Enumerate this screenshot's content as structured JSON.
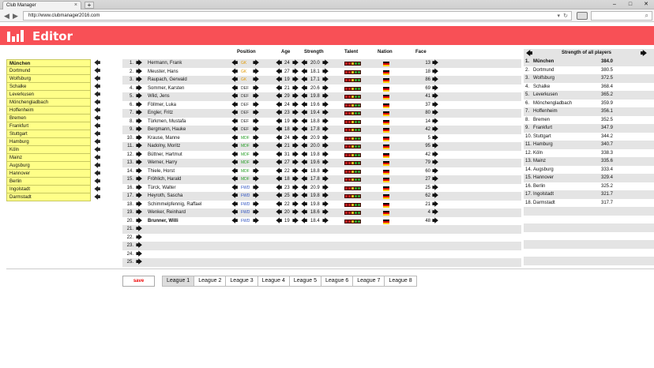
{
  "browser": {
    "tab_title": "Club Manager",
    "new_tab": "+",
    "url": "http://www.clubmanager2016.com",
    "window_controls": [
      "–",
      "□",
      "✕"
    ]
  },
  "header": {
    "title": "Editor"
  },
  "columns": {
    "position": "Position",
    "age": "Age",
    "strength": "Strength",
    "talent": "Talent",
    "nation": "Nation",
    "face": "Face"
  },
  "clubs": [
    "München",
    "Dortmund",
    "Wolfsburg",
    "Schalke",
    "Leverkusen",
    "Mönchengladbach",
    "Hoffenheim",
    "Bremen",
    "Frankfurt",
    "Stuttgart",
    "Hamburg",
    "Köln",
    "Mainz",
    "Augsburg",
    "Hannover",
    "Berlin",
    "Ingolstadt",
    "Darmstadt"
  ],
  "players": [
    {
      "num": "1.",
      "name": "Hermann, Frank",
      "pos": "GK",
      "age": "24",
      "strength": "20.0",
      "face": "13"
    },
    {
      "num": "2.",
      "name": "Meuster, Hans",
      "pos": "GK",
      "age": "27",
      "strength": "18.1",
      "face": "18"
    },
    {
      "num": "3.",
      "name": "Raupach, Gerwald",
      "pos": "GK",
      "age": "19",
      "strength": "17.1",
      "face": "86"
    },
    {
      "num": "4.",
      "name": "Sommer, Karsten",
      "pos": "DEF",
      "age": "21",
      "strength": "20.6",
      "face": "69"
    },
    {
      "num": "5.",
      "name": "Wild, Jens",
      "pos": "DEF",
      "age": "29",
      "strength": "19.8",
      "face": "41"
    },
    {
      "num": "6.",
      "name": "Föllmer, Luka",
      "pos": "DEF",
      "age": "24",
      "strength": "19.6",
      "face": "37"
    },
    {
      "num": "7.",
      "name": "Engler, Fritz",
      "pos": "DEF",
      "age": "23",
      "strength": "19.4",
      "face": "80"
    },
    {
      "num": "8.",
      "name": "Türkmen, Mustafa",
      "pos": "DEF",
      "age": "19",
      "strength": "18.8",
      "face": "14"
    },
    {
      "num": "9.",
      "name": "Bergmann, Hauke",
      "pos": "DEF",
      "age": "18",
      "strength": "17.8",
      "face": "42"
    },
    {
      "num": "10.",
      "name": "Krause, Manne",
      "pos": "MDF",
      "age": "24",
      "strength": "20.9",
      "face": "5"
    },
    {
      "num": "11.",
      "name": "Nadolny, Moritz",
      "pos": "MDF",
      "age": "21",
      "strength": "20.0",
      "face": "95"
    },
    {
      "num": "12.",
      "name": "Büttner, Hartmut",
      "pos": "MDF",
      "age": "31",
      "strength": "19.8",
      "face": "42"
    },
    {
      "num": "13.",
      "name": "Werner, Harry",
      "pos": "MDF",
      "age": "27",
      "strength": "19.6",
      "face": "79"
    },
    {
      "num": "14.",
      "name": "Thiele, Horst",
      "pos": "MDF",
      "age": "22",
      "strength": "18.8",
      "face": "60"
    },
    {
      "num": "15.",
      "name": "Fröhlich, Harald",
      "pos": "MDF",
      "age": "18",
      "strength": "17.8",
      "face": "27"
    },
    {
      "num": "16.",
      "name": "Türck, Walter",
      "pos": "FWD",
      "age": "23",
      "strength": "20.9",
      "face": "25"
    },
    {
      "num": "17.",
      "name": "Heyroth, Sascha",
      "pos": "FWD",
      "age": "25",
      "strength": "19.8",
      "face": "62"
    },
    {
      "num": "18.",
      "name": "Schimmelpfennig, Raffael",
      "pos": "FWD",
      "age": "22",
      "strength": "19.8",
      "face": "21"
    },
    {
      "num": "19.",
      "name": "Wenker, Reinhard",
      "pos": "FWD",
      "age": "20",
      "strength": "18.6",
      "face": "4"
    },
    {
      "num": "20.",
      "name": "Brunner, Willi",
      "pos": "FWD",
      "age": "19",
      "strength": "18.4",
      "face": "48",
      "bold": true
    },
    {
      "num": "21."
    },
    {
      "num": "22."
    },
    {
      "num": "23."
    },
    {
      "num": "24."
    },
    {
      "num": "25."
    }
  ],
  "strength_table": {
    "title": "Strength of all players",
    "rows": [
      {
        "rank": "1.",
        "club": "München",
        "value": "384.0"
      },
      {
        "rank": "2.",
        "club": "Dortmund",
        "value": "380.5"
      },
      {
        "rank": "3.",
        "club": "Wolfsburg",
        "value": "372.5"
      },
      {
        "rank": "4.",
        "club": "Schalke",
        "value": "368.4"
      },
      {
        "rank": "5.",
        "club": "Leverkusen",
        "value": "365.2"
      },
      {
        "rank": "6.",
        "club": "Mönchengladbach",
        "value": "359.9"
      },
      {
        "rank": "7.",
        "club": "Hoffenheim",
        "value": "356.1"
      },
      {
        "rank": "8.",
        "club": "Bremen",
        "value": "352.5"
      },
      {
        "rank": "9.",
        "club": "Frankfurt",
        "value": "347.9"
      },
      {
        "rank": "10.",
        "club": "Stuttgart",
        "value": "344.2"
      },
      {
        "rank": "11.",
        "club": "Hamburg",
        "value": "340.7"
      },
      {
        "rank": "12.",
        "club": "Köln",
        "value": "338.3"
      },
      {
        "rank": "13.",
        "club": "Mainz",
        "value": "335.6"
      },
      {
        "rank": "14.",
        "club": "Augsburg",
        "value": "333.4"
      },
      {
        "rank": "15.",
        "club": "Hannover",
        "value": "329.4"
      },
      {
        "rank": "16.",
        "club": "Berlin",
        "value": "325.2"
      },
      {
        "rank": "17.",
        "club": "Ingolstadt",
        "value": "321.7"
      },
      {
        "rank": "18.",
        "club": "Darmstadt",
        "value": "317.7"
      }
    ]
  },
  "save_label": "save",
  "leagues": [
    "League 1",
    "League 2",
    "League 3",
    "League 4",
    "League 5",
    "League 6",
    "League 7",
    "League 8"
  ],
  "colors": {
    "header": "#f85056",
    "club_bg": "#ffff88",
    "row_alt": "#e4e4e4",
    "talent_red": "#c02020",
    "talent_yellow": "#e0c020",
    "talent_green": "#30a030"
  }
}
